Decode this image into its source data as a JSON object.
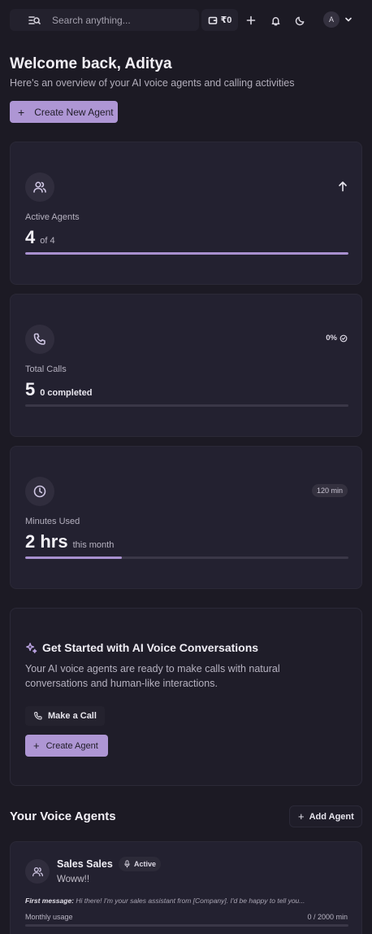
{
  "topbar": {
    "search_placeholder": "Search anything...",
    "wallet_amount": "₹0",
    "avatar_initial": "A"
  },
  "welcome": {
    "title": "Welcome back, Aditya",
    "subtitle": "Here's an overview of your AI voice agents and calling activities",
    "create_label": "Create New Agent"
  },
  "stats": {
    "active_agents": {
      "label": "Active Agents",
      "value": "4",
      "suffix": "of 4",
      "progress": 1.0
    },
    "total_calls": {
      "label": "Total Calls",
      "value": "5",
      "suffix": "0 completed",
      "badge": "0%",
      "progress": 0.0
    },
    "minutes_used": {
      "label": "Minutes Used",
      "value": "2 hrs",
      "suffix": "this month",
      "badge": "120 min",
      "progress": 0.3
    }
  },
  "get_started": {
    "title": "Get Started with AI Voice Conversations",
    "description": "Your AI voice agents are ready to make calls with natural conversations and human-like interactions.",
    "make_call_label": "Make a Call",
    "create_label": "Create Agent"
  },
  "agents_section": {
    "title": "Your Voice Agents",
    "add_label": "Add Agent",
    "agents": [
      {
        "name": "Sales Sales",
        "status": "Active",
        "description": "Woww!!",
        "first_message_label": "First message:",
        "first_message": "Hi there! I'm your sales assistant from [Company]. I'd be happy to tell you...",
        "usage_label": "Monthly usage",
        "usage_value": "0 / 2000 min",
        "usage_progress": 0.0
      }
    ]
  },
  "colors": {
    "background": "#1c1a24",
    "card": "#232130",
    "accent": "#ae96d4",
    "progress_fill": "#a890cf"
  }
}
